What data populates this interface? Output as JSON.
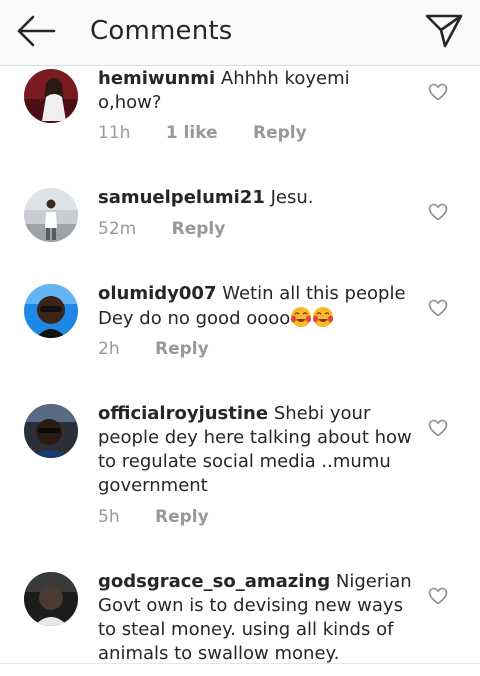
{
  "header": {
    "title": "Comments"
  },
  "icons": {
    "back": "back-arrow-icon",
    "direct": "direct-message-icon",
    "like": "heart-icon"
  },
  "comments": [
    {
      "username": "hemiwunmi",
      "text": "Ahhhh koyemi o,how?",
      "time": "11h",
      "likes": "1 like",
      "reply": "Reply"
    },
    {
      "username": "samuelpelumi21",
      "text": "Jesu.",
      "time": "52m",
      "reply": "Reply"
    },
    {
      "username": "olumidy007",
      "text": "Wetin all this people Dey do no good oooo",
      "time": "2h",
      "reply": "Reply"
    },
    {
      "username": "officialroyjustine",
      "text": "Shebi your people dey here talking about how to regulate social media ..mumu government",
      "time": "5h",
      "reply": "Reply"
    },
    {
      "username": "godsgrace_so_amazing",
      "text": "Nigerian Govt own is to devising new ways to steal money. using all kinds of animals to swallow money.",
      "time": "",
      "reply": ""
    }
  ]
}
